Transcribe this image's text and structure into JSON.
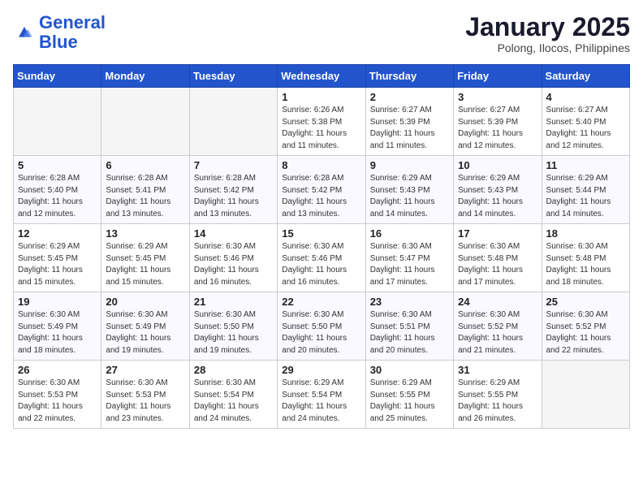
{
  "header": {
    "logo_text_general": "General",
    "logo_text_blue": "Blue",
    "month_year": "January 2025",
    "location": "Polong, Ilocos, Philippines"
  },
  "weekdays": [
    "Sunday",
    "Monday",
    "Tuesday",
    "Wednesday",
    "Thursday",
    "Friday",
    "Saturday"
  ],
  "weeks": [
    [
      {
        "day": "",
        "sunrise": "",
        "sunset": "",
        "daylight": "",
        "empty": true
      },
      {
        "day": "",
        "sunrise": "",
        "sunset": "",
        "daylight": "",
        "empty": true
      },
      {
        "day": "",
        "sunrise": "",
        "sunset": "",
        "daylight": "",
        "empty": true
      },
      {
        "day": "1",
        "sunrise": "Sunrise: 6:26 AM",
        "sunset": "Sunset: 5:38 PM",
        "daylight": "Daylight: 11 hours and 11 minutes."
      },
      {
        "day": "2",
        "sunrise": "Sunrise: 6:27 AM",
        "sunset": "Sunset: 5:39 PM",
        "daylight": "Daylight: 11 hours and 11 minutes."
      },
      {
        "day": "3",
        "sunrise": "Sunrise: 6:27 AM",
        "sunset": "Sunset: 5:39 PM",
        "daylight": "Daylight: 11 hours and 12 minutes."
      },
      {
        "day": "4",
        "sunrise": "Sunrise: 6:27 AM",
        "sunset": "Sunset: 5:40 PM",
        "daylight": "Daylight: 11 hours and 12 minutes."
      }
    ],
    [
      {
        "day": "5",
        "sunrise": "Sunrise: 6:28 AM",
        "sunset": "Sunset: 5:40 PM",
        "daylight": "Daylight: 11 hours and 12 minutes."
      },
      {
        "day": "6",
        "sunrise": "Sunrise: 6:28 AM",
        "sunset": "Sunset: 5:41 PM",
        "daylight": "Daylight: 11 hours and 13 minutes."
      },
      {
        "day": "7",
        "sunrise": "Sunrise: 6:28 AM",
        "sunset": "Sunset: 5:42 PM",
        "daylight": "Daylight: 11 hours and 13 minutes."
      },
      {
        "day": "8",
        "sunrise": "Sunrise: 6:28 AM",
        "sunset": "Sunset: 5:42 PM",
        "daylight": "Daylight: 11 hours and 13 minutes."
      },
      {
        "day": "9",
        "sunrise": "Sunrise: 6:29 AM",
        "sunset": "Sunset: 5:43 PM",
        "daylight": "Daylight: 11 hours and 14 minutes."
      },
      {
        "day": "10",
        "sunrise": "Sunrise: 6:29 AM",
        "sunset": "Sunset: 5:43 PM",
        "daylight": "Daylight: 11 hours and 14 minutes."
      },
      {
        "day": "11",
        "sunrise": "Sunrise: 6:29 AM",
        "sunset": "Sunset: 5:44 PM",
        "daylight": "Daylight: 11 hours and 14 minutes."
      }
    ],
    [
      {
        "day": "12",
        "sunrise": "Sunrise: 6:29 AM",
        "sunset": "Sunset: 5:45 PM",
        "daylight": "Daylight: 11 hours and 15 minutes."
      },
      {
        "day": "13",
        "sunrise": "Sunrise: 6:29 AM",
        "sunset": "Sunset: 5:45 PM",
        "daylight": "Daylight: 11 hours and 15 minutes."
      },
      {
        "day": "14",
        "sunrise": "Sunrise: 6:30 AM",
        "sunset": "Sunset: 5:46 PM",
        "daylight": "Daylight: 11 hours and 16 minutes."
      },
      {
        "day": "15",
        "sunrise": "Sunrise: 6:30 AM",
        "sunset": "Sunset: 5:46 PM",
        "daylight": "Daylight: 11 hours and 16 minutes."
      },
      {
        "day": "16",
        "sunrise": "Sunrise: 6:30 AM",
        "sunset": "Sunset: 5:47 PM",
        "daylight": "Daylight: 11 hours and 17 minutes."
      },
      {
        "day": "17",
        "sunrise": "Sunrise: 6:30 AM",
        "sunset": "Sunset: 5:48 PM",
        "daylight": "Daylight: 11 hours and 17 minutes."
      },
      {
        "day": "18",
        "sunrise": "Sunrise: 6:30 AM",
        "sunset": "Sunset: 5:48 PM",
        "daylight": "Daylight: 11 hours and 18 minutes."
      }
    ],
    [
      {
        "day": "19",
        "sunrise": "Sunrise: 6:30 AM",
        "sunset": "Sunset: 5:49 PM",
        "daylight": "Daylight: 11 hours and 18 minutes."
      },
      {
        "day": "20",
        "sunrise": "Sunrise: 6:30 AM",
        "sunset": "Sunset: 5:49 PM",
        "daylight": "Daylight: 11 hours and 19 minutes."
      },
      {
        "day": "21",
        "sunrise": "Sunrise: 6:30 AM",
        "sunset": "Sunset: 5:50 PM",
        "daylight": "Daylight: 11 hours and 19 minutes."
      },
      {
        "day": "22",
        "sunrise": "Sunrise: 6:30 AM",
        "sunset": "Sunset: 5:50 PM",
        "daylight": "Daylight: 11 hours and 20 minutes."
      },
      {
        "day": "23",
        "sunrise": "Sunrise: 6:30 AM",
        "sunset": "Sunset: 5:51 PM",
        "daylight": "Daylight: 11 hours and 20 minutes."
      },
      {
        "day": "24",
        "sunrise": "Sunrise: 6:30 AM",
        "sunset": "Sunset: 5:52 PM",
        "daylight": "Daylight: 11 hours and 21 minutes."
      },
      {
        "day": "25",
        "sunrise": "Sunrise: 6:30 AM",
        "sunset": "Sunset: 5:52 PM",
        "daylight": "Daylight: 11 hours and 22 minutes."
      }
    ],
    [
      {
        "day": "26",
        "sunrise": "Sunrise: 6:30 AM",
        "sunset": "Sunset: 5:53 PM",
        "daylight": "Daylight: 11 hours and 22 minutes."
      },
      {
        "day": "27",
        "sunrise": "Sunrise: 6:30 AM",
        "sunset": "Sunset: 5:53 PM",
        "daylight": "Daylight: 11 hours and 23 minutes."
      },
      {
        "day": "28",
        "sunrise": "Sunrise: 6:30 AM",
        "sunset": "Sunset: 5:54 PM",
        "daylight": "Daylight: 11 hours and 24 minutes."
      },
      {
        "day": "29",
        "sunrise": "Sunrise: 6:29 AM",
        "sunset": "Sunset: 5:54 PM",
        "daylight": "Daylight: 11 hours and 24 minutes."
      },
      {
        "day": "30",
        "sunrise": "Sunrise: 6:29 AM",
        "sunset": "Sunset: 5:55 PM",
        "daylight": "Daylight: 11 hours and 25 minutes."
      },
      {
        "day": "31",
        "sunrise": "Sunrise: 6:29 AM",
        "sunset": "Sunset: 5:55 PM",
        "daylight": "Daylight: 11 hours and 26 minutes."
      },
      {
        "day": "",
        "sunrise": "",
        "sunset": "",
        "daylight": "",
        "empty": true
      }
    ]
  ]
}
